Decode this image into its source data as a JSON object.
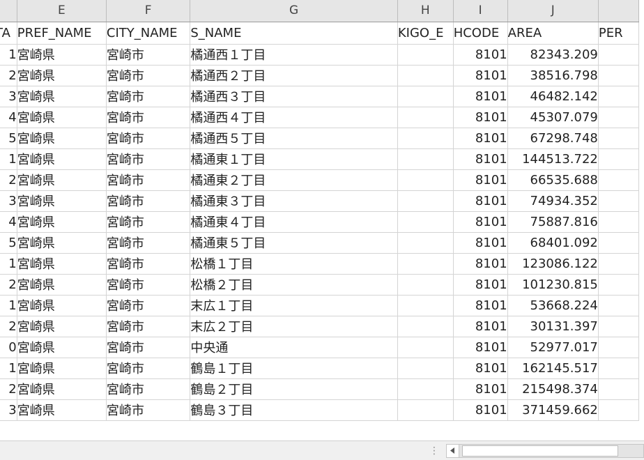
{
  "columns": [
    "",
    "E",
    "F",
    "G",
    "H",
    "I",
    "J",
    ""
  ],
  "fields": [
    "TA",
    "PREF_NAME",
    "CITY_NAME",
    "S_NAME",
    "KIGO_E",
    "HCODE",
    "AREA",
    "PER"
  ],
  "rows": [
    {
      "d": "1",
      "pref": "宮崎県",
      "city": "宮崎市",
      "sname": "橘通西１丁目",
      "kigo": "",
      "hcode": "8101",
      "area": "82343.209"
    },
    {
      "d": "2",
      "pref": "宮崎県",
      "city": "宮崎市",
      "sname": "橘通西２丁目",
      "kigo": "",
      "hcode": "8101",
      "area": "38516.798"
    },
    {
      "d": "3",
      "pref": "宮崎県",
      "city": "宮崎市",
      "sname": "橘通西３丁目",
      "kigo": "",
      "hcode": "8101",
      "area": "46482.142"
    },
    {
      "d": "4",
      "pref": "宮崎県",
      "city": "宮崎市",
      "sname": "橘通西４丁目",
      "kigo": "",
      "hcode": "8101",
      "area": "45307.079"
    },
    {
      "d": "5",
      "pref": "宮崎県",
      "city": "宮崎市",
      "sname": "橘通西５丁目",
      "kigo": "",
      "hcode": "8101",
      "area": "67298.748"
    },
    {
      "d": "1",
      "pref": "宮崎県",
      "city": "宮崎市",
      "sname": "橘通東１丁目",
      "kigo": "",
      "hcode": "8101",
      "area": "144513.722"
    },
    {
      "d": "2",
      "pref": "宮崎県",
      "city": "宮崎市",
      "sname": "橘通東２丁目",
      "kigo": "",
      "hcode": "8101",
      "area": "66535.688"
    },
    {
      "d": "3",
      "pref": "宮崎県",
      "city": "宮崎市",
      "sname": "橘通東３丁目",
      "kigo": "",
      "hcode": "8101",
      "area": "74934.352"
    },
    {
      "d": "4",
      "pref": "宮崎県",
      "city": "宮崎市",
      "sname": "橘通東４丁目",
      "kigo": "",
      "hcode": "8101",
      "area": "75887.816"
    },
    {
      "d": "5",
      "pref": "宮崎県",
      "city": "宮崎市",
      "sname": "橘通東５丁目",
      "kigo": "",
      "hcode": "8101",
      "area": "68401.092"
    },
    {
      "d": "1",
      "pref": "宮崎県",
      "city": "宮崎市",
      "sname": "松橋１丁目",
      "kigo": "",
      "hcode": "8101",
      "area": "123086.122"
    },
    {
      "d": "2",
      "pref": "宮崎県",
      "city": "宮崎市",
      "sname": "松橋２丁目",
      "kigo": "",
      "hcode": "8101",
      "area": "101230.815"
    },
    {
      "d": "1",
      "pref": "宮崎県",
      "city": "宮崎市",
      "sname": "末広１丁目",
      "kigo": "",
      "hcode": "8101",
      "area": "53668.224"
    },
    {
      "d": "2",
      "pref": "宮崎県",
      "city": "宮崎市",
      "sname": "末広２丁目",
      "kigo": "",
      "hcode": "8101",
      "area": "30131.397"
    },
    {
      "d": "0",
      "pref": "宮崎県",
      "city": "宮崎市",
      "sname": "中央通",
      "kigo": "",
      "hcode": "8101",
      "area": "52977.017"
    },
    {
      "d": "1",
      "pref": "宮崎県",
      "city": "宮崎市",
      "sname": "鶴島１丁目",
      "kigo": "",
      "hcode": "8101",
      "area": "162145.517"
    },
    {
      "d": "2",
      "pref": "宮崎県",
      "city": "宮崎市",
      "sname": "鶴島２丁目",
      "kigo": "",
      "hcode": "8101",
      "area": "215498.374"
    },
    {
      "d": "3",
      "pref": "宮崎県",
      "city": "宮崎市",
      "sname": "鶴島３丁目",
      "kigo": "",
      "hcode": "8101",
      "area": "371459.662"
    }
  ],
  "statusbar": {
    "split_handle": "⋮",
    "scroll_left_icon": "triangle-left-icon"
  }
}
